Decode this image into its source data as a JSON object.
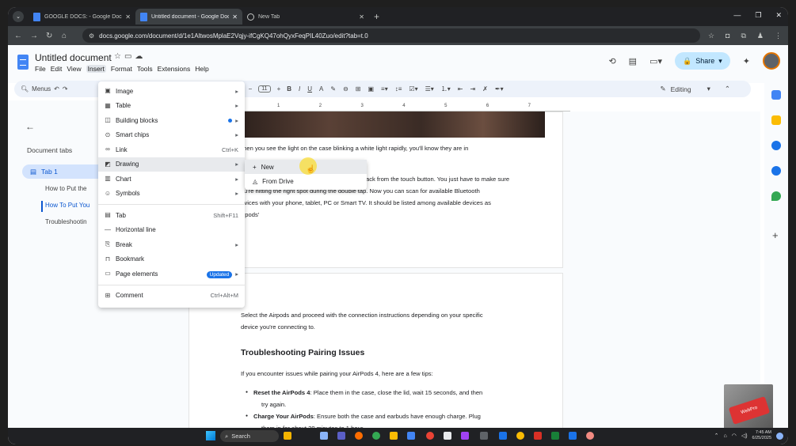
{
  "browser": {
    "tabs": [
      {
        "title": "GOOGLE DOCS: - Google Docs",
        "active": false
      },
      {
        "title": "Untitled document - Google Docs",
        "active": true
      },
      {
        "title": "New Tab",
        "active": false
      }
    ],
    "url": "docs.google.com/document/d/1e1AltwosMplaE2Vqjy-ifCgKQ47ohQyxFeqPIL40Zuo/edit?tab=t.0"
  },
  "doc": {
    "title": "Untitled document",
    "menus": [
      "File",
      "Edit",
      "View",
      "Insert",
      "Format",
      "Tools",
      "Extensions",
      "Help"
    ],
    "share_label": "Share",
    "accent": "#0b57d0"
  },
  "toolbar": {
    "menus_label": "Menus",
    "font": "Arial",
    "font_size": "11",
    "editing_label": "Editing"
  },
  "sidebar": {
    "heading": "Document tabs",
    "tab1": "Tab 1",
    "subitems": [
      "How to Put the",
      "How To Put You",
      "Troubleshootin"
    ]
  },
  "ruler": [
    "1",
    "2",
    "3",
    "4",
    "5",
    "6",
    "7"
  ],
  "insert_menu": {
    "items": [
      {
        "label": "Image",
        "icon": "image-icon",
        "right": "▸"
      },
      {
        "label": "Table",
        "icon": "table-icon",
        "right": "▸"
      },
      {
        "label": "Building blocks",
        "icon": "building-blocks-icon",
        "right": "▸"
      },
      {
        "label": "Smart chips",
        "icon": "smart-chips-icon",
        "right": "▸"
      },
      {
        "label": "Link",
        "icon": "link-icon",
        "right": "Ctrl+K"
      },
      {
        "label": "Drawing",
        "icon": "drawing-icon",
        "right": "▸"
      },
      {
        "label": "Chart",
        "icon": "chart-icon",
        "right": "▸"
      },
      {
        "label": "Symbols",
        "icon": "symbols-icon",
        "right": "▸"
      },
      {
        "label": "Tab",
        "icon": "tab-icon",
        "right": "Shift+F11"
      },
      {
        "label": "Horizontal line",
        "icon": "horizontal-line-icon",
        "right": ""
      },
      {
        "label": "Break",
        "icon": "break-icon",
        "right": "▸"
      },
      {
        "label": "Bookmark",
        "icon": "bookmark-icon",
        "right": ""
      },
      {
        "label": "Page elements",
        "icon": "page-elements-icon",
        "right": "▸",
        "badge": "Updated"
      },
      {
        "label": "Comment",
        "icon": "comment-icon",
        "right": "Ctrl+Alt+M"
      }
    ]
  },
  "drawing_submenu": [
    {
      "label": "New",
      "icon": "plus-icon"
    },
    {
      "label": "From Drive",
      "icon": "drive-icon"
    }
  ],
  "page1": {
    "lines": [
      "When you see the light on the case blinking a white light rapidly, you'll know they are in",
      "ack from the touch button. You just have to make sure",
      "you're hitting the right spot during the double tap. Now you can scan for available Bluetooth",
      "devices with your phone, tablet, PC or Smart TV. It should be listed among available devices as",
      "Airpods'"
    ]
  },
  "page2": {
    "para1": "Select the Airpods and proceed with the connection instructions depending on your specific",
    "para1b": "device you're connecting to.",
    "heading": "Troubleshooting Pairing Issues",
    "intro": "If you encounter issues while pairing your AirPods 4, here are a few tips:",
    "bullets": [
      {
        "bold": "Reset the AirPods 4",
        "text": ": Place them in the case, close the lid, wait 15 seconds, and then",
        "cont": "try again."
      },
      {
        "bold": "Charge Your AirPods",
        "text": ": Ensure both the case and earbuds have enough charge. Plug",
        "cont": "them in for about 30 minutes to 1 hour."
      }
    ]
  },
  "taskbar": {
    "search": "Search",
    "time": "7:45 AM",
    "date": "6/25/2025"
  },
  "webcam_label": "WebPro"
}
